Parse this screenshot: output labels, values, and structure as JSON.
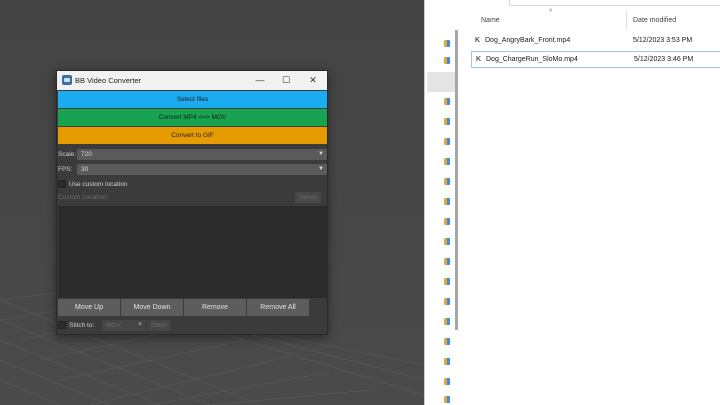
{
  "window": {
    "title": "BB Video Converter",
    "minimize": "—",
    "maximize": "☐",
    "close": "✕"
  },
  "buttons": {
    "select_files": "Select files",
    "convert_mov": "Convert MP4 <=> MOV",
    "convert_gif": "Convert to GIF"
  },
  "scale": {
    "label": "Scale:",
    "value": "720"
  },
  "fps": {
    "label": "FPS:",
    "value": "30"
  },
  "custom_location": {
    "checkbox_label": "Use custom location",
    "label": "Custom Location:",
    "select_label": "Select"
  },
  "actions": {
    "move_up": "Move Up",
    "move_down": "Move Down",
    "remove": "Remove",
    "remove_all": "Remove All"
  },
  "stitch": {
    "label": "Stitch to:",
    "format": "MOV",
    "button": "Stitch"
  },
  "explorer": {
    "columns": {
      "name": "Name",
      "date": "Date modified"
    },
    "files": [
      {
        "name": "Dog_AngryBark_Front.mp4",
        "date": "5/12/2023 3:53 PM",
        "icon": "K"
      },
      {
        "name": "Dog_ChargeRun_SloMo.mp4",
        "date": "5/12/2023 3:46 PM",
        "icon": "K"
      }
    ]
  },
  "colors": {
    "select_files": "#1aabf0",
    "convert_mov": "#17a350",
    "convert_gif": "#e69c00"
  }
}
